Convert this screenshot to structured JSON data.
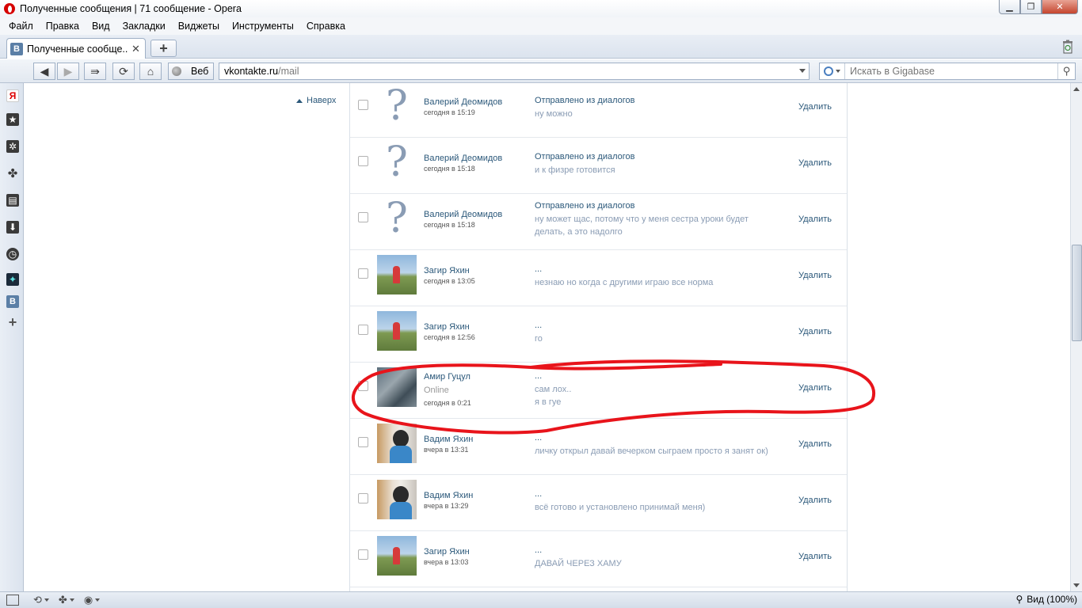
{
  "window": {
    "title": "Полученные сообщения | 71 сообщение - Opera"
  },
  "menu": [
    "Файл",
    "Правка",
    "Вид",
    "Закладки",
    "Виджеты",
    "Инструменты",
    "Справка"
  ],
  "tab": {
    "favicon": "В",
    "title": "Полученные сообще..."
  },
  "nav": {
    "web_label": "Веб",
    "url_host": "vkontakte.ru",
    "url_path": "/mail",
    "search_placeholder": "Искать в Gigabase"
  },
  "sidepanel": {
    "vk_label": "В"
  },
  "page": {
    "up_link": "Наверх",
    "messages": [
      {
        "sender": "Валерий Деомидов",
        "time": "сегодня в 15:19",
        "subject": "Отправлено из диалогов",
        "body": "ну можно",
        "avatar": "question",
        "delete": "Удалить"
      },
      {
        "sender": "Валерий Деомидов",
        "time": "сегодня в 15:18",
        "subject": "Отправлено из диалогов",
        "body": "и к физре готовится",
        "avatar": "question",
        "delete": "Удалить"
      },
      {
        "sender": "Валерий Деомидов",
        "time": "сегодня в 15:18",
        "subject": "Отправлено из диалогов",
        "body": "ну может щас, потому что у меня сестра уроки будет делать, а это надолго",
        "avatar": "question",
        "delete": "Удалить"
      },
      {
        "sender": "Загир Яхин",
        "time": "сегодня в 13:05",
        "subject": "...",
        "body": "незнаю но когда с другими играю все норма",
        "avatar": "field",
        "delete": "Удалить"
      },
      {
        "sender": "Загир Яхин",
        "time": "сегодня в 12:56",
        "subject": "...",
        "body": "го",
        "avatar": "field",
        "delete": "Удалить"
      },
      {
        "sender": "Амир Гуцул",
        "status": "Online",
        "time": "сегодня в 0:21",
        "subject": "...",
        "body": "сам лох..",
        "body2": "я в гуе",
        "avatar": "group",
        "delete": "Удалить"
      },
      {
        "sender": "Вадим Яхин",
        "time": "вчера в 13:31",
        "subject": "...",
        "body": "личку открыл давай вечерком сыграем просто я занят ок)",
        "avatar": "boy",
        "delete": "Удалить"
      },
      {
        "sender": "Вадим Яхин",
        "time": "вчера в 13:29",
        "subject": "...",
        "body": "всё готово и установлено принимай меня)",
        "avatar": "boy",
        "delete": "Удалить"
      },
      {
        "sender": "Загир Яхин",
        "time": "вчера в 13:03",
        "subject": "...",
        "body": "ДАВАЙ ЧЕРЕЗ ХАМУ",
        "avatar": "field",
        "delete": "Удалить"
      }
    ]
  },
  "status": {
    "zoom": "Вид (100%)"
  },
  "colors": {
    "link": "#2b587a",
    "muted": "#8a9cb4",
    "annotation": "#e8141b"
  }
}
